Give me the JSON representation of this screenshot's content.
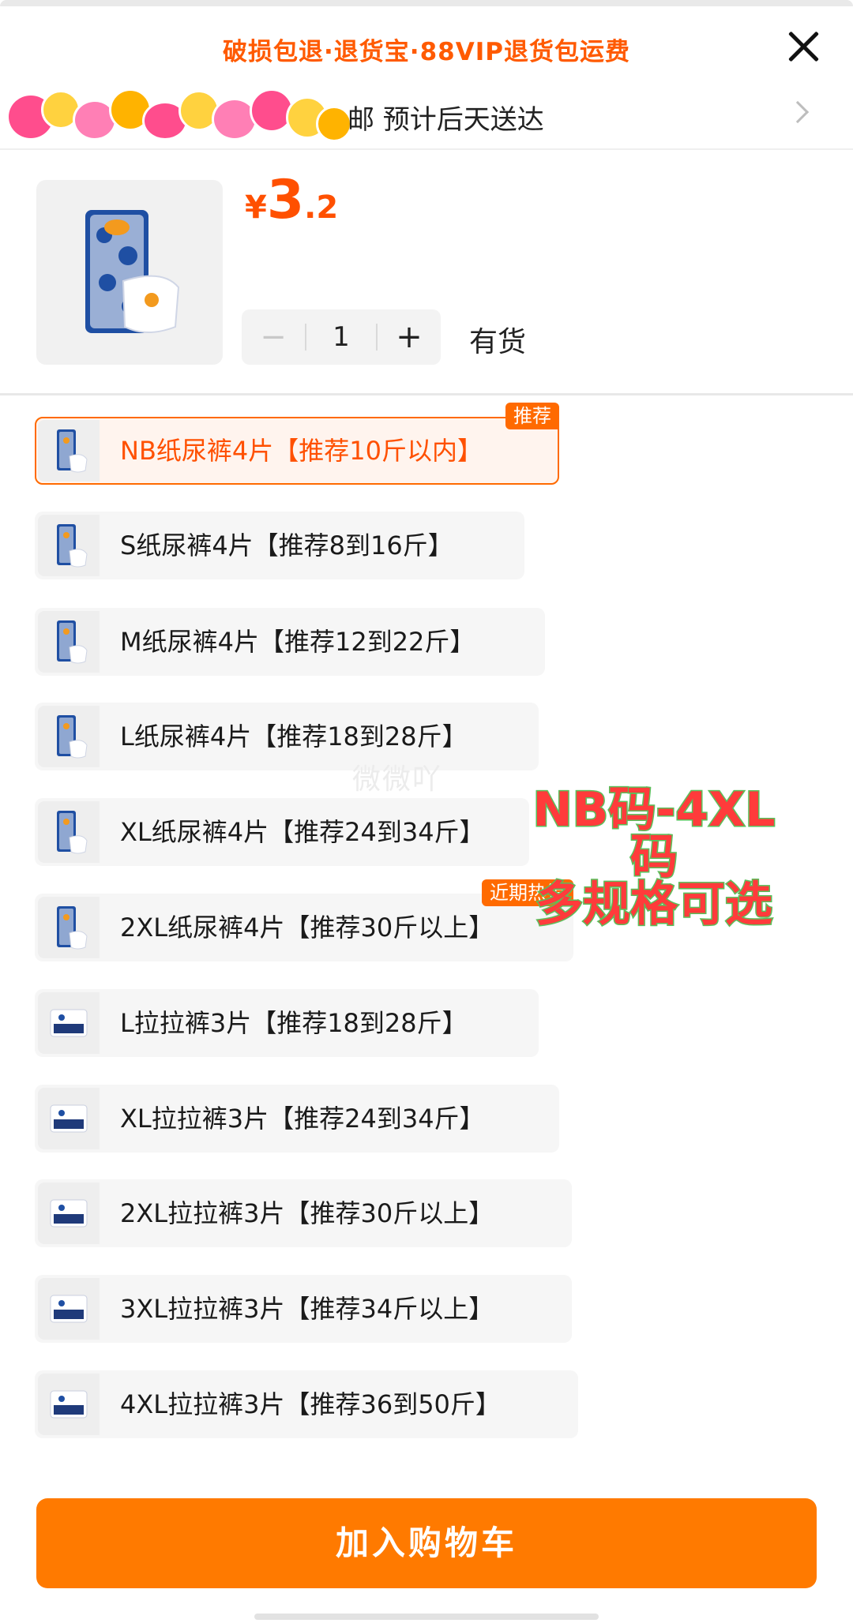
{
  "header": {
    "guarantee_text": "破损包退·退货宝·88VIP退货包运费",
    "shipping_text": "邮 预计后天送达"
  },
  "product": {
    "price_symbol": "¥",
    "price_int": "3",
    "price_dec": ".2",
    "quantity": "1",
    "minus_label": "−",
    "plus_label": "+",
    "stock_label": "有货"
  },
  "sku_list": [
    {
      "label": "NB纸尿裤4片【推荐10斤以内】",
      "badge": "推荐",
      "selected": true,
      "type": "diaper"
    },
    {
      "label": "S纸尿裤4片【推荐8到16斤】",
      "badge": "",
      "selected": false,
      "type": "diaper"
    },
    {
      "label": "M纸尿裤4片【推荐12到22斤】",
      "badge": "",
      "selected": false,
      "type": "diaper"
    },
    {
      "label": "L纸尿裤4片【推荐18到28斤】",
      "badge": "",
      "selected": false,
      "type": "diaper"
    },
    {
      "label": "XL纸尿裤4片【推荐24到34斤】",
      "badge": "",
      "selected": false,
      "type": "diaper"
    },
    {
      "label": "2XL纸尿裤4片【推荐30斤以上】",
      "badge": "近期热销",
      "selected": false,
      "type": "diaper"
    },
    {
      "label": "L拉拉裤3片【推荐18到28斤】",
      "badge": "",
      "selected": false,
      "type": "pants"
    },
    {
      "label": "XL拉拉裤3片【推荐24到34斤】",
      "badge": "",
      "selected": false,
      "type": "pants"
    },
    {
      "label": "2XL拉拉裤3片【推荐30斤以上】",
      "badge": "",
      "selected": false,
      "type": "pants"
    },
    {
      "label": "3XL拉拉裤3片【推荐34斤以上】",
      "badge": "",
      "selected": false,
      "type": "pants"
    },
    {
      "label": "4XL拉拉裤3片【推荐36到50斤】",
      "badge": "",
      "selected": false,
      "type": "pants"
    }
  ],
  "watermark": "微微吖",
  "promo": {
    "line1": "NB码-4XL码",
    "line2": "多规格可选"
  },
  "footer": {
    "cart_button": "加入购物车"
  },
  "colors": {
    "accent": "#ff5000",
    "button": "#ff7a00",
    "promo_fill": "#ff3b3b",
    "promo_stroke": "#5bbf5b"
  }
}
